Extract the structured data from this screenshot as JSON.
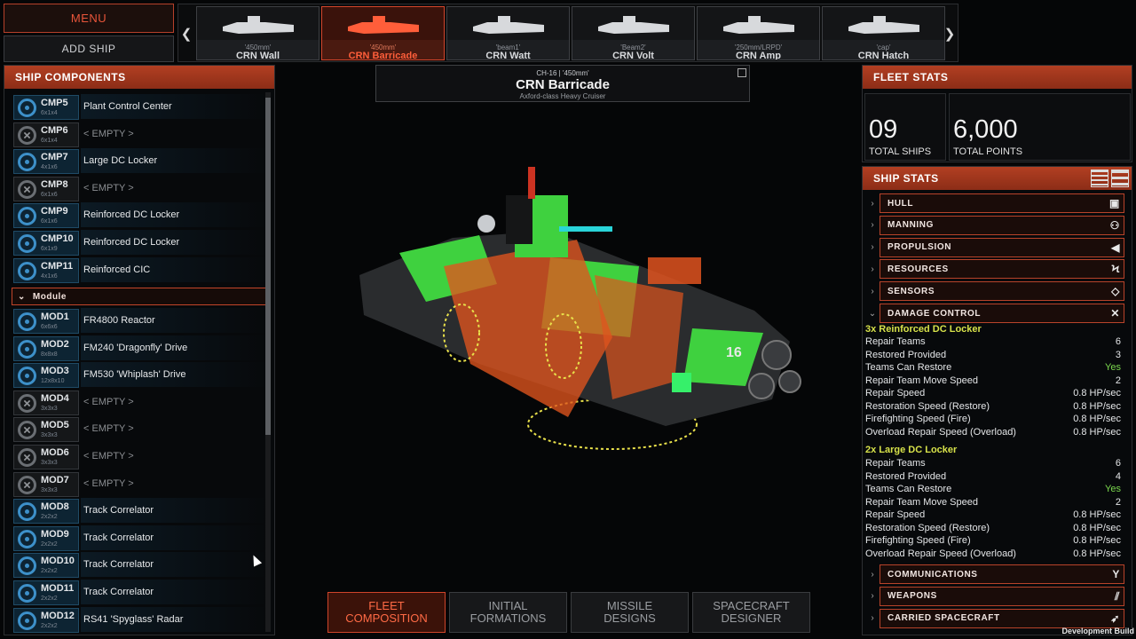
{
  "top": {
    "menu_label": "MENU",
    "add_ship_label": "ADD SHIP"
  },
  "ships": [
    {
      "cls": "'450mm'",
      "name": "CRN Wall",
      "selected": false
    },
    {
      "cls": "'450mm'",
      "name": "CRN Barricade",
      "selected": true
    },
    {
      "cls": "'beam1'",
      "name": "CRN Watt",
      "selected": false
    },
    {
      "cls": "'Beam2'",
      "name": "CRN Volt",
      "selected": false
    },
    {
      "cls": "'250mm/LRPD'",
      "name": "CRN Amp",
      "selected": false
    },
    {
      "cls": "'cap'",
      "name": "CRN Hatch",
      "selected": false
    }
  ],
  "components": {
    "title": "SHIP COMPONENTS",
    "module_header": "Module",
    "comp_rows": [
      {
        "code": "CMP5",
        "size": "6x1x4",
        "name": "Plant Control Center",
        "empty": false
      },
      {
        "code": "CMP6",
        "size": "6x1x4",
        "name": "< EMPTY >",
        "empty": true
      },
      {
        "code": "CMP7",
        "size": "4x1x6",
        "name": "Large DC Locker",
        "empty": false
      },
      {
        "code": "CMP8",
        "size": "6x1x6",
        "name": "< EMPTY >",
        "empty": true
      },
      {
        "code": "CMP9",
        "size": "6x1x6",
        "name": "Reinforced DC Locker",
        "empty": false
      },
      {
        "code": "CMP10",
        "size": "6x1x9",
        "name": "Reinforced DC Locker",
        "empty": false
      },
      {
        "code": "CMP11",
        "size": "4x1x6",
        "name": "Reinforced CIC",
        "empty": false
      }
    ],
    "mod_rows": [
      {
        "code": "MOD1",
        "size": "6x6x6",
        "name": "FR4800 Reactor",
        "empty": false
      },
      {
        "code": "MOD2",
        "size": "8x8x8",
        "name": "FM240 'Dragonfly' Drive",
        "empty": false
      },
      {
        "code": "MOD3",
        "size": "12x8x10",
        "name": "FM530 'Whiplash' Drive",
        "empty": false
      },
      {
        "code": "MOD4",
        "size": "3x3x3",
        "name": "< EMPTY >",
        "empty": true
      },
      {
        "code": "MOD5",
        "size": "3x3x3",
        "name": "< EMPTY >",
        "empty": true
      },
      {
        "code": "MOD6",
        "size": "3x3x3",
        "name": "< EMPTY >",
        "empty": true
      },
      {
        "code": "MOD7",
        "size": "3x3x3",
        "name": "< EMPTY >",
        "empty": true
      },
      {
        "code": "MOD8",
        "size": "2x2x2",
        "name": "Track Correlator",
        "empty": false
      },
      {
        "code": "MOD9",
        "size": "2x2x2",
        "name": "Track Correlator",
        "empty": false
      },
      {
        "code": "MOD10",
        "size": "2x2x2",
        "name": "Track Correlator",
        "empty": false
      },
      {
        "code": "MOD11",
        "size": "2x2x2",
        "name": "Track Correlator",
        "empty": false
      },
      {
        "code": "MOD12",
        "size": "2x2x2",
        "name": "RS41 'Spyglass' Radar",
        "empty": false
      }
    ]
  },
  "shipinfo": {
    "tag": "CH-16 | '450mm'",
    "title": "CRN Barricade",
    "subtitle": "Axford-class Heavy Cruiser",
    "hull_number": "16"
  },
  "tabs": [
    {
      "l1": "FLEET",
      "l2": "COMPOSITION",
      "selected": true
    },
    {
      "l1": "INITIAL",
      "l2": "FORMATIONS",
      "selected": false
    },
    {
      "l1": "MISSILE",
      "l2": "DESIGNS",
      "selected": false
    },
    {
      "l1": "SPACECRAFT",
      "l2": "DESIGNER",
      "selected": false
    }
  ],
  "fleet": {
    "title": "FLEET STATS",
    "ships_value": "09",
    "ships_label": "TOTAL SHIPS",
    "points_value": "6,000",
    "points_label": "TOTAL POINTS"
  },
  "shipstats": {
    "title": "SHIP STATS",
    "cats_top": [
      {
        "label": "Hull",
        "icon": "hull-icon",
        "glyph": "▣"
      },
      {
        "label": "Manning",
        "icon": "crew-icon",
        "glyph": "⚇"
      },
      {
        "label": "Propulsion",
        "icon": "engine-icon",
        "glyph": "◀"
      },
      {
        "label": "Resources",
        "icon": "lightning-icon",
        "glyph": "ϟ"
      },
      {
        "label": "Sensors",
        "icon": "diamond-icon",
        "glyph": "◇"
      }
    ],
    "dc_label": "Damage Control",
    "dc_glyph": "✕",
    "groups": [
      {
        "header": "3x Reinforced DC Locker",
        "rows": [
          {
            "k": "Repair Teams",
            "v": "6"
          },
          {
            "k": "Restored Provided",
            "v": "3"
          },
          {
            "k": "Teams Can Restore",
            "v": "Yes"
          },
          {
            "k": "Repair Team Move Speed",
            "v": "2"
          },
          {
            "k": "Repair Speed",
            "v": "0.8 HP/sec"
          },
          {
            "k": "Restoration Speed (Restore)",
            "v": "0.8 HP/sec"
          },
          {
            "k": "Firefighting Speed (Fire)",
            "v": "0.8 HP/sec"
          },
          {
            "k": "Overload Repair Speed (Overload)",
            "v": "0.8 HP/sec"
          }
        ]
      },
      {
        "header": "2x Large DC Locker",
        "rows": [
          {
            "k": "Repair Teams",
            "v": "6"
          },
          {
            "k": "Restored Provided",
            "v": "4"
          },
          {
            "k": "Teams Can Restore",
            "v": "Yes"
          },
          {
            "k": "Repair Team Move Speed",
            "v": "2"
          },
          {
            "k": "Repair Speed",
            "v": "0.8 HP/sec"
          },
          {
            "k": "Restoration Speed (Restore)",
            "v": "0.8 HP/sec"
          },
          {
            "k": "Firefighting Speed (Fire)",
            "v": "0.8 HP/sec"
          },
          {
            "k": "Overload Repair Speed (Overload)",
            "v": "0.8 HP/sec"
          }
        ]
      }
    ],
    "cats_bottom": [
      {
        "label": "Communications",
        "icon": "antenna-icon",
        "glyph": "Y"
      },
      {
        "label": "Weapons",
        "icon": "weapons-icon",
        "glyph": "⫽"
      },
      {
        "label": "Carried Spacecraft",
        "icon": "spacecraft-icon",
        "glyph": "➶"
      }
    ]
  },
  "dev_build": "Development Build",
  "colors": {
    "accent": "#b23f22",
    "selected_text": "#ff5e3a",
    "dc_header": "#d7e24a",
    "yes": "#7bd84e"
  }
}
